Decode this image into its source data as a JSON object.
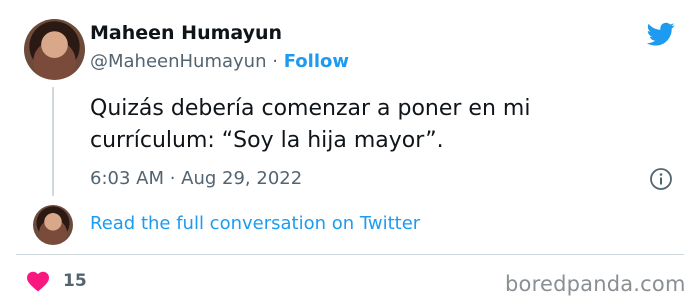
{
  "author": {
    "name": "Maheen Humayun",
    "handle": "@MaheenHumayun",
    "separator": "·",
    "follow_label": "Follow"
  },
  "tweet": {
    "text_line1": "Quizás debería comenzar a poner en mi",
    "text_line2": "currículum: “Soy la hija mayor”.",
    "timestamp": "6:03 AM · Aug 29, 2022"
  },
  "thread": {
    "read_link": "Read the full conversation on Twitter"
  },
  "engagement": {
    "likes": "15"
  },
  "watermark": "boredpanda.com",
  "colors": {
    "twitter_blue": "#1d9bf0",
    "like_pink": "#f91880",
    "secondary_text": "#536471"
  },
  "icons": {
    "brand": "twitter-bird-icon",
    "info": "info-icon",
    "like": "heart-icon"
  }
}
